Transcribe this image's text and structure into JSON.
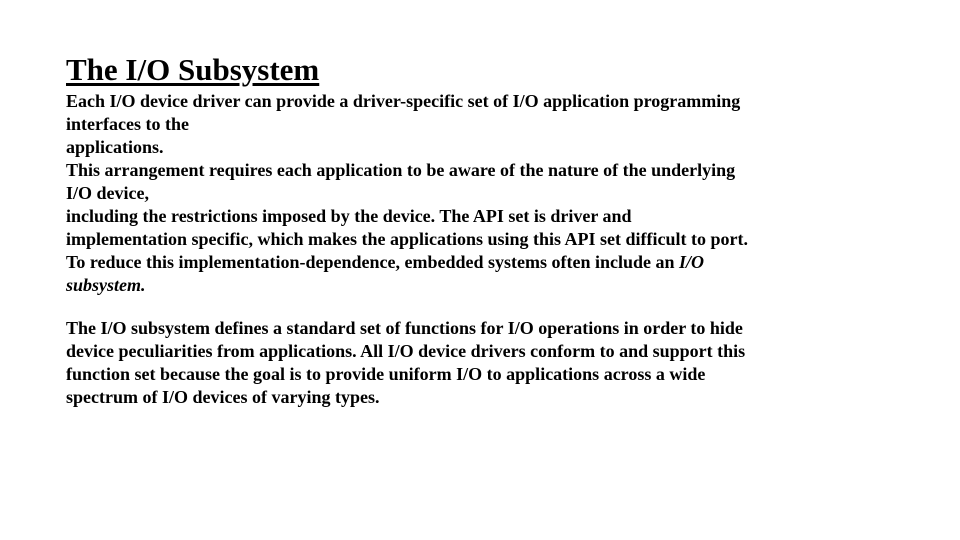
{
  "title": "The I/O Subsystem",
  "p1": {
    "l1": "Each I/O device driver can provide a driver-specific set of I/O application programming",
    "l2": "interfaces to the",
    "l3": "applications.",
    "l4": "This arrangement requires each application to be aware of the nature of the underlying",
    "l5": "I/O device,",
    "l6": "including the restrictions imposed by the device. The API set is driver and",
    "l7": "implementation specific, which makes the applications using this API set difficult to port.",
    "l8a": "To reduce this implementation-dependence, embedded systems often include an ",
    "l8b": "I/O",
    "l9": "subsystem."
  },
  "p2": {
    "l1": "The I/O subsystem defines a standard set of functions for I/O operations in order to hide",
    "l2": "device peculiarities from applications. All I/O device drivers conform to and support this",
    "l3": "function set because the goal is to provide uniform I/O to applications across a wide",
    "l4": "spectrum of I/O devices of varying types."
  }
}
